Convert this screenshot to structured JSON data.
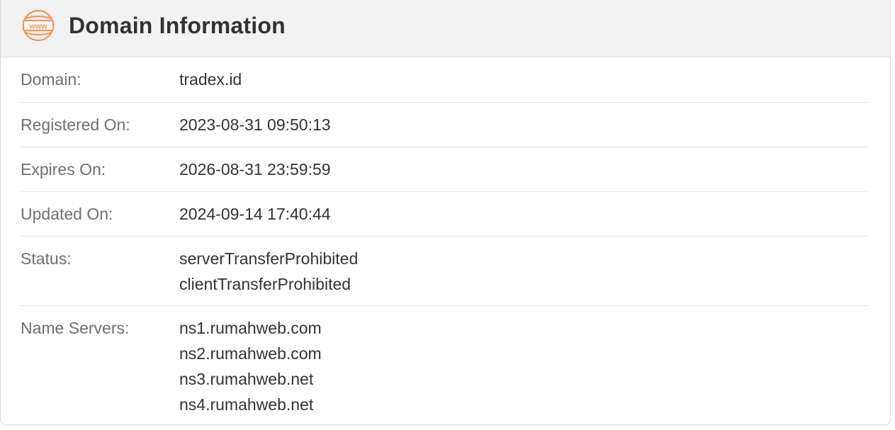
{
  "header": {
    "title": "Domain Information",
    "icon": "www-globe-icon",
    "icon_text": "www",
    "icon_color": "#f0965a"
  },
  "domain_info": {
    "domain": {
      "label": "Domain:",
      "value": "tradex.id"
    },
    "registered_on": {
      "label": "Registered On:",
      "value": "2023-08-31 09:50:13"
    },
    "expires_on": {
      "label": "Expires On:",
      "value": "2026-08-31 23:59:59"
    },
    "updated_on": {
      "label": "Updated On:",
      "value": "2024-09-14 17:40:44"
    },
    "status": {
      "label": "Status:",
      "values": [
        "serverTransferProhibited",
        "clientTransferProhibited"
      ]
    },
    "name_servers": {
      "label": "Name Servers:",
      "values": [
        "ns1.rumahweb.com",
        "ns2.rumahweb.com",
        "ns3.rumahweb.net",
        "ns4.rumahweb.net"
      ]
    }
  }
}
